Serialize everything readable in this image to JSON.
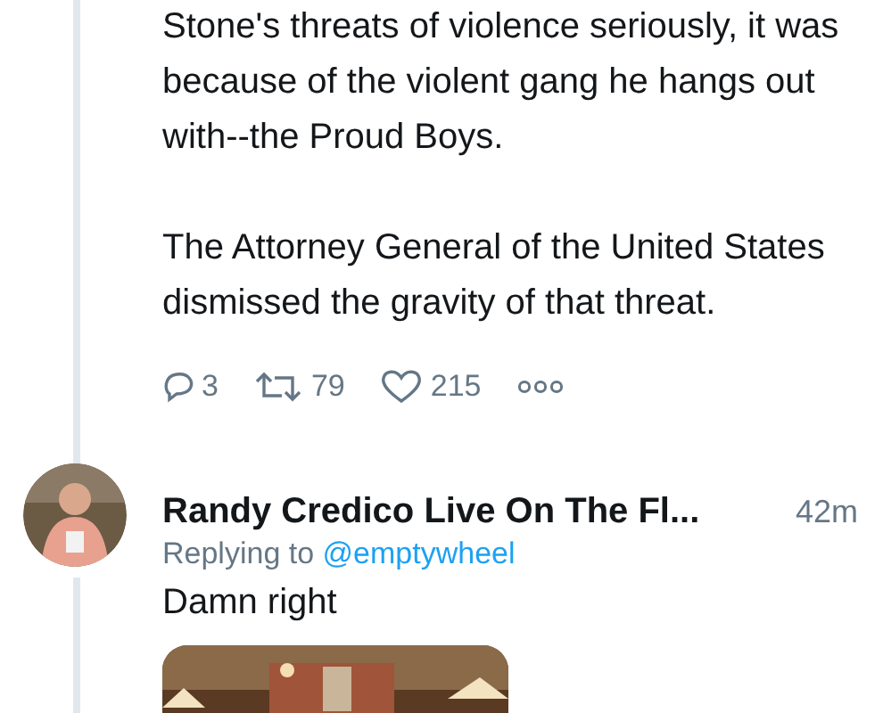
{
  "tweet": {
    "paragraphs": [
      "Stone's threats of violence seriously, it was because of the violent gang he hangs out with--the Proud Boys.",
      "The Attorney General of the United States dismissed the gravity of that threat."
    ],
    "actions": [
      {
        "kind": "reply",
        "count": "3"
      },
      {
        "kind": "retweet",
        "count": "79"
      },
      {
        "kind": "like",
        "count": "215"
      },
      {
        "kind": "more"
      }
    ]
  },
  "reply": {
    "name": "Randy Credico Live On The Fl...",
    "time": "42m",
    "replying_label": "Replying to",
    "replying_handle": "@emptywheel",
    "text": "Damn right"
  }
}
